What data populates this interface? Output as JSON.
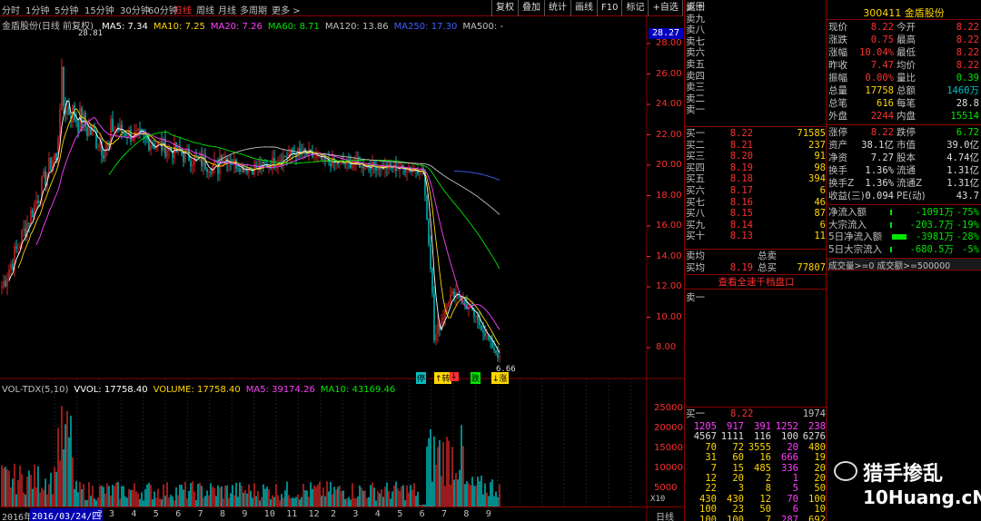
{
  "toolbar": {
    "periods": [
      "分时",
      "1分钟",
      "5分钟",
      "15分钟",
      "30分钟",
      "60分钟",
      "日线",
      "周线",
      "月线",
      "多周期",
      "更多 >"
    ],
    "active": "日线",
    "right_buttons": [
      "复权",
      "叠加",
      "统计",
      "画线",
      "F10",
      "标记",
      "+自选",
      "返回"
    ]
  },
  "legend": {
    "stock": "金盾股份(日线 前复权)",
    "items": [
      {
        "label": "MA5: 7.34",
        "color": "#ffffff"
      },
      {
        "label": "MA10: 7.25",
        "color": "#ffd700"
      },
      {
        "label": "MA20: 7.26",
        "color": "#ff40ff"
      },
      {
        "label": "MA60: 8.71",
        "color": "#00e600"
      },
      {
        "label": "MA120: 13.86",
        "color": "#c0c0c0"
      },
      {
        "label": "MA250: 17.30",
        "color": "#4060ff"
      },
      {
        "label": "MA500: -",
        "color": "#c0c0c0"
      }
    ]
  },
  "price_axis": {
    "ticks": [
      "28.00",
      "26.00",
      "24.00",
      "22.00",
      "20.00",
      "18.00",
      "16.00",
      "14.00",
      "12.00",
      "10.00",
      "8.00"
    ],
    "highlight": "28.27",
    "high_label": "28.81",
    "low_label": "6.66"
  },
  "vol_legend": {
    "items": [
      {
        "label": "VOL-TDX(5,10)",
        "color": "#c0c0c0"
      },
      {
        "label": "VVOL: 17758.40",
        "color": "#ffffff"
      },
      {
        "label": "VOLUME: 17758.40",
        "color": "#ffd700"
      },
      {
        "label": "MA5: 39174.26",
        "color": "#ff40ff"
      },
      {
        "label": "MA10: 43169.46",
        "color": "#00e600"
      }
    ]
  },
  "vol_axis": {
    "ticks": [
      "25000",
      "20000",
      "15000",
      "10000",
      "5000"
    ],
    "unit": "X10"
  },
  "bottom": {
    "year": "2016年",
    "date": "2016/03/24/四",
    "period": "日线",
    "months": [
      "12",
      "2",
      "3",
      "4",
      "5",
      "6",
      "7",
      "8",
      "9",
      "10",
      "11",
      "12",
      "2",
      "3",
      "4",
      "5",
      "6",
      "7",
      "8",
      "9"
    ]
  },
  "markers": [
    {
      "text": "停",
      "color": "#00c0c0"
    },
    {
      "text": "↑转",
      "color": "#ffd700"
    },
    {
      "text": "↓",
      "color": "#ff3030"
    },
    {
      "text": "跌",
      "color": "#00e600"
    },
    {
      "text": "↓涨",
      "color": "#ffd700"
    }
  ],
  "asks": [
    {
      "label": "卖十"
    },
    {
      "label": "卖九"
    },
    {
      "label": "卖八"
    },
    {
      "label": "卖七"
    },
    {
      "label": "卖六"
    },
    {
      "label": "卖五"
    },
    {
      "label": "卖四"
    },
    {
      "label": "卖三"
    },
    {
      "label": "卖二"
    },
    {
      "label": "卖一"
    }
  ],
  "bids": [
    {
      "label": "买一",
      "price": "8.22",
      "vol": "71585"
    },
    {
      "label": "买二",
      "price": "8.21",
      "vol": "237"
    },
    {
      "label": "买三",
      "price": "8.20",
      "vol": "91"
    },
    {
      "label": "买四",
      "price": "8.19",
      "vol": "98"
    },
    {
      "label": "买五",
      "price": "8.18",
      "vol": "394"
    },
    {
      "label": "买六",
      "price": "8.17",
      "vol": "6"
    },
    {
      "label": "买七",
      "price": "8.16",
      "vol": "46"
    },
    {
      "label": "买八",
      "price": "8.15",
      "vol": "87"
    },
    {
      "label": "买九",
      "price": "8.14",
      "vol": "6"
    },
    {
      "label": "买十",
      "price": "8.13",
      "vol": "11"
    }
  ],
  "summary": {
    "ask_avg": "卖均",
    "ask_total": "总卖",
    "bid_avg": "买均",
    "bid_avg_val": "8.19",
    "bid_total": "总买",
    "bid_total_val": "77807"
  },
  "full_depth_btn": "查看全速千档盘口",
  "ask1_label": "卖一",
  "queue_header": {
    "label": "买一",
    "price": "8.22",
    "count": "1974"
  },
  "queue": [
    [
      "1205",
      "917",
      "391",
      "1252",
      "238"
    ],
    [
      "4567",
      "1111",
      "116",
      "100",
      "6276"
    ],
    [
      "70",
      "72",
      "3555",
      "20",
      "480"
    ],
    [
      "31",
      "60",
      "16",
      "666",
      "19"
    ],
    [
      "7",
      "15",
      "485",
      "336",
      "20"
    ],
    [
      "12",
      "20",
      "2",
      "1",
      "20"
    ],
    [
      "22",
      "3",
      "8",
      "5",
      "50"
    ],
    [
      "430",
      "430",
      "12",
      "70",
      "100"
    ],
    [
      "100",
      "23",
      "50",
      "6",
      "10"
    ],
    [
      "100",
      "100",
      "7",
      "287",
      "692"
    ]
  ],
  "quote": {
    "code": "300411 金盾股份",
    "rows": [
      [
        "现价",
        "8.22",
        "今开",
        "8.22"
      ],
      [
        "涨跌",
        "0.75",
        "最高",
        "8.22"
      ],
      [
        "涨幅",
        "10.04%",
        "最低",
        "8.22"
      ],
      [
        "昨收",
        "7.47",
        "均价",
        "8.22"
      ],
      [
        "振幅",
        "0.00%",
        "量比",
        "0.39"
      ],
      [
        "总量",
        "17758",
        "总额",
        "1460万"
      ],
      [
        "总笔",
        "616",
        "每笔",
        "28.8"
      ],
      [
        "外盘",
        "2244",
        "内盘",
        "15514"
      ]
    ],
    "rows2": [
      [
        "涨停",
        "8.22",
        "跌停",
        "6.72"
      ],
      [
        "资产",
        "38.1亿",
        "市值",
        "39.0亿"
      ],
      [
        "净资",
        "7.27",
        "股本",
        "4.74亿"
      ],
      [
        "换手",
        "1.36%",
        "流通",
        "1.31亿"
      ],
      [
        "换手Z",
        "1.36%",
        "流通Z",
        "1.31亿"
      ],
      [
        "收益(三)",
        "0.094",
        "PE(动)",
        "43.7"
      ]
    ],
    "flows": [
      {
        "label": "净流入额",
        "value": "-1091万",
        "pct": "-75%"
      },
      {
        "label": "大宗流入",
        "value": "-203.7万",
        "pct": "-19%"
      },
      {
        "label": "5日净流入额",
        "value": "-3981万",
        "pct": "-28%"
      },
      {
        "label": "5日大宗流入",
        "value": "-680.5万",
        "pct": "-5%"
      }
    ],
    "filter": "成交量>=0 成交额>=500000"
  },
  "watermark": {
    "brand": "猎手掺乱",
    "site": "10Huang.cN"
  },
  "colors": {
    "up": "#ff3030",
    "down": "#00e600",
    "frame": "#880000"
  }
}
